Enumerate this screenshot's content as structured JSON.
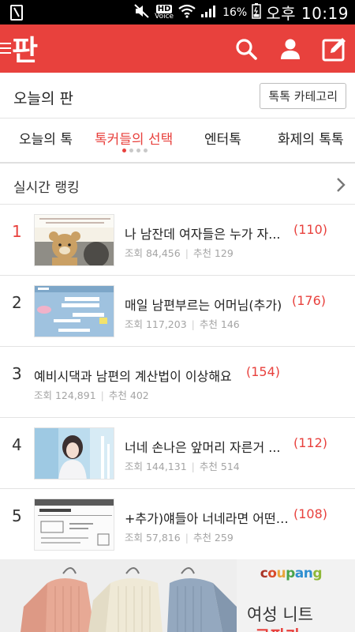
{
  "status_bar": {
    "network": "HD",
    "network_sub": "Voice",
    "battery": "16%",
    "time": "오후 10:19"
  },
  "app_bar": {
    "logo": "판",
    "icons": [
      "search-icon",
      "person-icon",
      "edit-icon"
    ]
  },
  "section": {
    "title": "오늘의 판",
    "category_button": "톡톡 카테고리"
  },
  "tabs": [
    {
      "label": "오늘의 톡",
      "active": false
    },
    {
      "label": "톡커들의 선택",
      "active": true
    },
    {
      "label": "엔터톡",
      "active": false
    },
    {
      "label": "화제의 톡톡",
      "active": false
    }
  ],
  "ranking": {
    "title": "실시간 랭킹",
    "items": [
      {
        "rank": "1",
        "title": "나 남잔데 여자들은 누가 자...",
        "comments": "(110)",
        "views": "조회 84,456",
        "recommend": "추천 129",
        "thumb": "teddy-bear"
      },
      {
        "rank": "2",
        "title": "매일 남편부르는 어머님(추가)",
        "comments": "(176)",
        "views": "조회 117,203",
        "recommend": "추천 146",
        "thumb": "chat-screenshot"
      },
      {
        "rank": "3",
        "title": "예비시댁과 남편의 계산법이 이상해요",
        "comments": "(154)",
        "views": "조회 124,891",
        "recommend": "추천 402",
        "thumb": null
      },
      {
        "rank": "4",
        "title": "너네 손나은 앞머리 자른거 ...",
        "comments": "(112)",
        "views": "조회 144,131",
        "recommend": "추천 514",
        "thumb": "portrait"
      },
      {
        "rank": "5",
        "title": "+추가)얘들아 너네라면 어떤 ...",
        "comments": "(108)",
        "views": "조회 57,816",
        "recommend": "추천 259",
        "thumb": "document"
      }
    ]
  },
  "ad": {
    "brand": "coupang",
    "title": "여성 니트",
    "subtitle": "쿠팡가"
  },
  "colors": {
    "brand_red": "#e8413d",
    "meta_gray": "#a4a4a4"
  }
}
